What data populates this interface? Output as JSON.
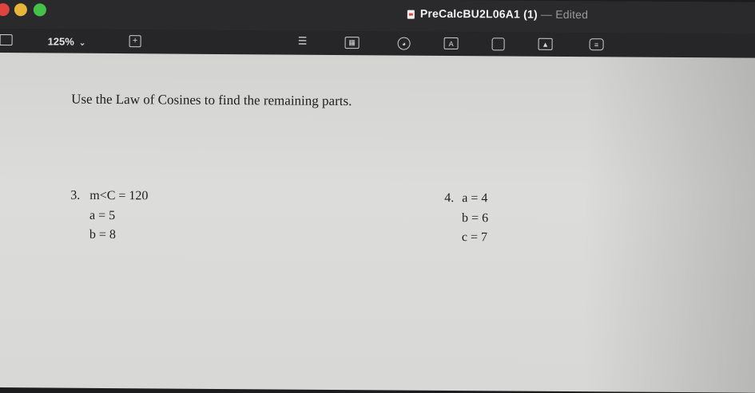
{
  "window": {
    "title": "PreCalcBU2L06A1 (1)",
    "title_separator": "—",
    "status": "Edited"
  },
  "toolbar": {
    "zoom_value": "125%",
    "icons": [
      "sidebar-icon",
      "zoom-chevron-icon",
      "insert-icon",
      "text-icon",
      "table-icon",
      "chart-icon",
      "shape-icon",
      "media-icon",
      "image-icon",
      "comment-icon"
    ]
  },
  "document": {
    "instruction": "Use the Law of Cosines to find the remaining parts.",
    "problems": [
      {
        "number": "3.",
        "lines": [
          "m<C = 120",
          "a = 5",
          "b = 8"
        ]
      },
      {
        "number": "4.",
        "lines": [
          "a = 4",
          "b = 6",
          "c = 7"
        ]
      }
    ]
  },
  "colors": {
    "titlebar": "#2a2a2c",
    "toolbar": "#262628",
    "page": "#d8d8d6",
    "traffic_red": "#e0443e",
    "traffic_yellow": "#e6b53a",
    "traffic_green": "#45c14a"
  }
}
